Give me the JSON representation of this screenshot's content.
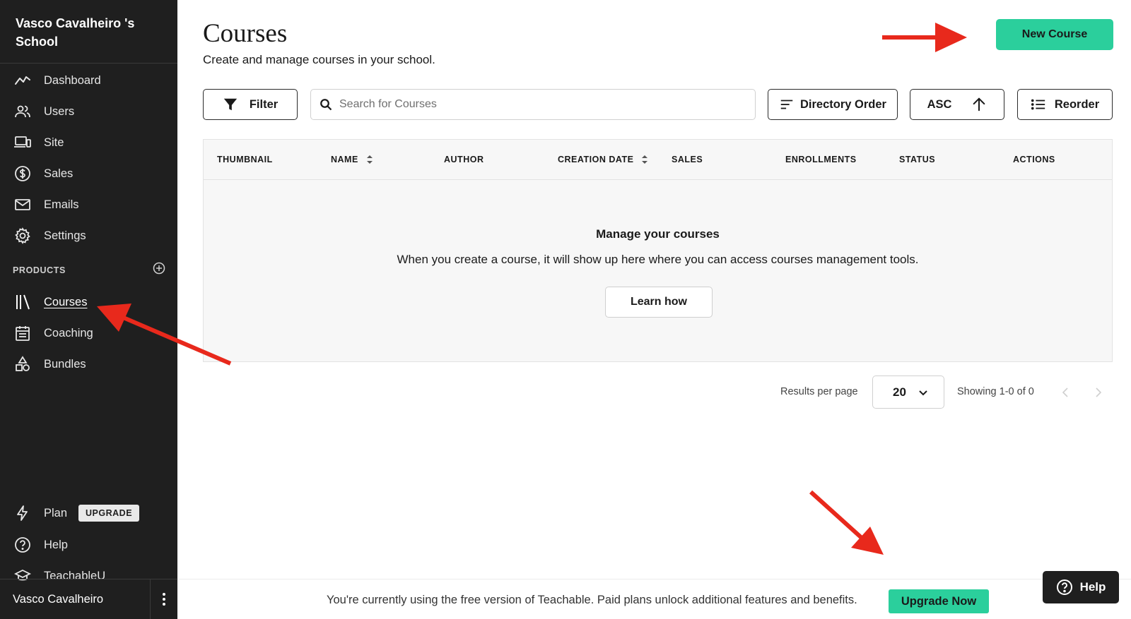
{
  "sidebar": {
    "school_name": "Vasco Cavalheiro 's School",
    "nav": [
      {
        "label": "Dashboard",
        "icon": "dashboard-icon"
      },
      {
        "label": "Users",
        "icon": "users-icon"
      },
      {
        "label": "Site",
        "icon": "site-icon"
      },
      {
        "label": "Sales",
        "icon": "sales-icon"
      },
      {
        "label": "Emails",
        "icon": "email-icon"
      },
      {
        "label": "Settings",
        "icon": "settings-icon"
      }
    ],
    "products_header": "PRODUCTS",
    "products": [
      {
        "label": "Courses",
        "icon": "courses-icon",
        "active": true
      },
      {
        "label": "Coaching",
        "icon": "coaching-icon"
      },
      {
        "label": "Bundles",
        "icon": "bundles-icon"
      }
    ],
    "bottom_nav": [
      {
        "label": "Plan",
        "icon": "plan-icon",
        "badge": "UPGRADE"
      },
      {
        "label": "Help",
        "icon": "help-icon"
      },
      {
        "label": "TeachableU",
        "icon": "teachableu-icon"
      }
    ],
    "user_name": "Vasco Cavalheiro"
  },
  "header": {
    "title": "Courses",
    "subtitle": "Create and manage courses in your school.",
    "new_course_label": "New Course"
  },
  "toolbar": {
    "filter_label": "Filter",
    "search_placeholder": "Search for Courses",
    "directory_order_label": "Directory Order",
    "sort_direction_label": "ASC",
    "reorder_label": "Reorder"
  },
  "table": {
    "columns": [
      "THUMBNAIL",
      "NAME",
      "AUTHOR",
      "CREATION DATE",
      "SALES",
      "ENROLLMENTS",
      "STATUS",
      "ACTIONS"
    ],
    "empty_title": "Manage your courses",
    "empty_text": "When you create a course, it will show up here where you can access courses management tools.",
    "learn_how_label": "Learn how"
  },
  "pagination": {
    "results_per_page_label": "Results per page",
    "results_per_page_value": "20",
    "showing_text": "Showing 1-0 of 0"
  },
  "banner": {
    "message": "You're currently using the free version of Teachable. Paid plans unlock additional features and benefits.",
    "upgrade_label": "Upgrade Now"
  },
  "help_widget": {
    "label": "Help"
  },
  "colors": {
    "sidebar_bg": "#1f1f1f",
    "accent_green": "#2bcf9c",
    "annotation_red": "#e8291c"
  }
}
